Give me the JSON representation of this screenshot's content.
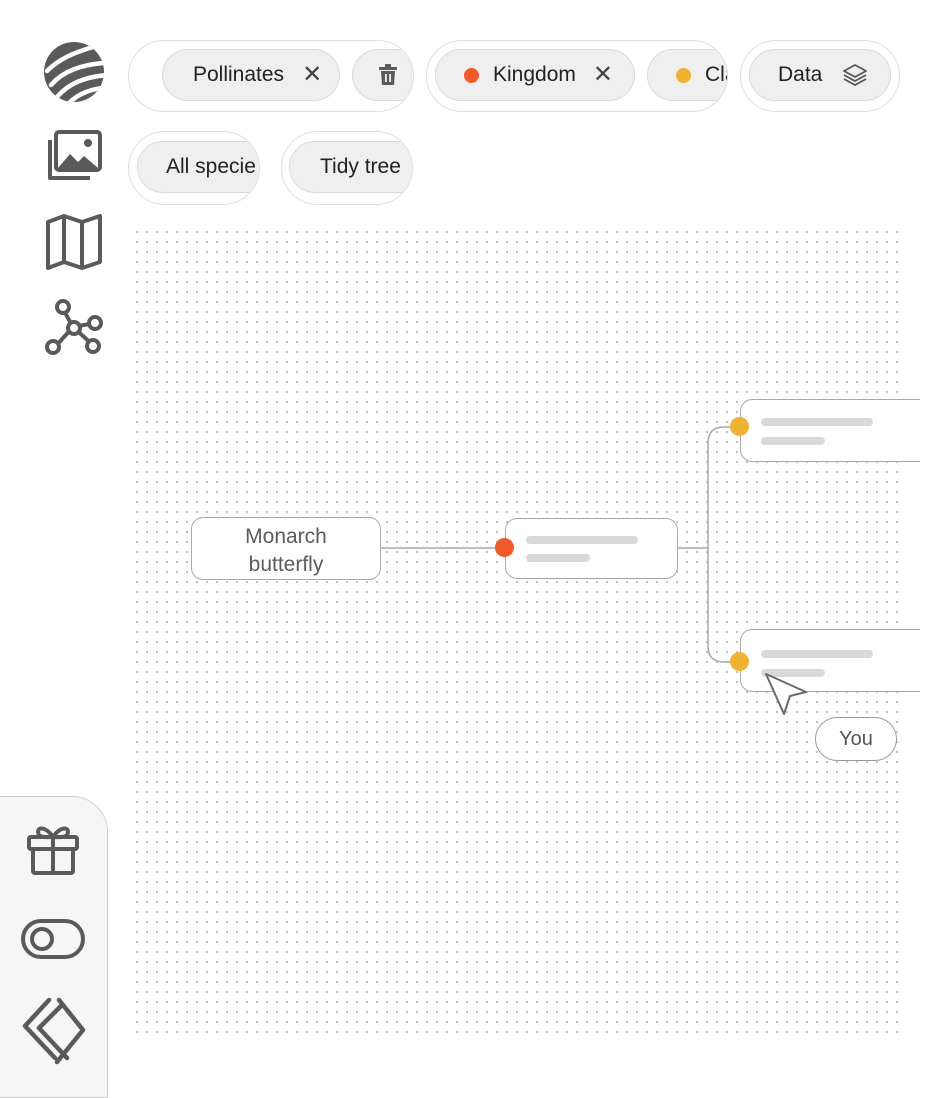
{
  "rail": {
    "icons": [
      "brand-logo-icon",
      "gallery-icon",
      "map-icon",
      "network-graph-icon"
    ]
  },
  "bottom_panel": {
    "icons": [
      "gift-icon",
      "toggle-icon",
      "collapse-chevrons-icon"
    ]
  },
  "filters": {
    "row1": [
      {
        "label": "Pollinates",
        "removable": true
      },
      {
        "icon": "trash-icon"
      }
    ],
    "row1b": [
      {
        "label": "Kingdom",
        "dot_color": "#f15a2b",
        "removable": true
      },
      {
        "label": "Cla",
        "dot_color": "#f0b232"
      }
    ],
    "data_button": {
      "label": "Data",
      "icon": "layers-icon"
    },
    "row2": [
      {
        "label": "All specie"
      },
      {
        "label": "Tidy tree"
      }
    ]
  },
  "tree": {
    "root_label_line1": "Monarch",
    "root_label_line2": "butterfly",
    "kingdom_color": "#f15a2b",
    "class_color": "#f0b232"
  },
  "cursor": {
    "label": "You"
  }
}
